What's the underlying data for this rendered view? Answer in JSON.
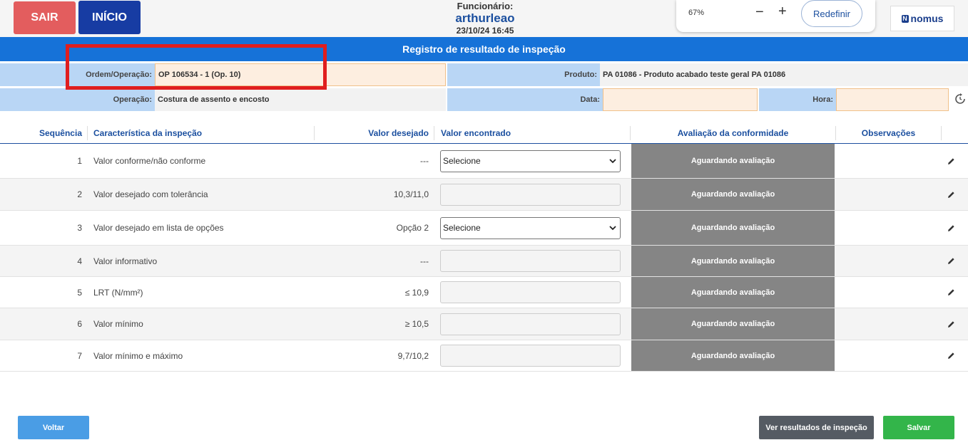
{
  "header": {
    "sair_label": "SAIR",
    "inicio_label": "INÍCIO",
    "funcionario_label": "Funcionário:",
    "funcionario_user": "arthurleao",
    "datetime": "23/10/24 16:45",
    "zoom_value": "67%",
    "zoom_minus": "−",
    "zoom_plus": "+",
    "reset_label": "Redefinir",
    "logo_text": "nomus"
  },
  "title": "Registro de resultado de inspeção",
  "info": {
    "ordem_label": "Ordem/Operação:",
    "ordem_value": "OP 106534 - 1 (Op. 10)",
    "produto_label": "Produto:",
    "produto_value": "PA 01086 - Produto acabado teste geral PA 01086",
    "operacao_label": "Operação:",
    "operacao_value": "Costura de assento e encosto",
    "data_label": "Data:",
    "data_value": "",
    "hora_label": "Hora:",
    "hora_value": ""
  },
  "table": {
    "headers": {
      "seq": "Sequência",
      "car": "Característica da inspeção",
      "des": "Valor desejado",
      "enc": "Valor encontrado",
      "aval": "Avaliação da conformidade",
      "obs": "Observações"
    },
    "rows": [
      {
        "seq": "1",
        "car": "Valor conforme/não conforme",
        "des": "---",
        "enc_type": "select",
        "enc_value": "Selecione",
        "aval": "Aguardando avaliação"
      },
      {
        "seq": "2",
        "car": "Valor desejado com tolerância",
        "des": "10,3/11,0",
        "enc_type": "input",
        "enc_value": "",
        "aval": "Aguardando avaliação"
      },
      {
        "seq": "3",
        "car": "Valor desejado em lista de opções",
        "des": "Opção 2",
        "enc_type": "select",
        "enc_value": "Selecione",
        "aval": "Aguardando avaliação"
      },
      {
        "seq": "4",
        "car": "Valor informativo",
        "des": "---",
        "enc_type": "input",
        "enc_value": "",
        "aval": "Aguardando avaliação"
      },
      {
        "seq": "5",
        "car": "LRT (N/mm²)",
        "des": "≤ 10,9",
        "enc_type": "input",
        "enc_value": "",
        "aval": "Aguardando avaliação"
      },
      {
        "seq": "6",
        "car": "Valor mínimo",
        "des": "≥ 10,5",
        "enc_type": "input",
        "enc_value": "",
        "aval": "Aguardando avaliação"
      },
      {
        "seq": "7",
        "car": "Valor mínimo e máximo",
        "des": "9,7/10,2",
        "enc_type": "input",
        "enc_value": "",
        "aval": "Aguardando avaliação"
      }
    ]
  },
  "footer": {
    "voltar_label": "Voltar",
    "ver_label": "Ver resultados de inspeção",
    "salvar_label": "Salvar"
  },
  "colors": {
    "sair": "#e35d5e",
    "inicio": "#173ca3",
    "title_bar": "#1672d8",
    "label_bg": "#b9d6f5",
    "peach_field": "#fdeee0",
    "aval_bg": "#858585",
    "voltar": "#4a9de5",
    "ver": "#555b63",
    "salvar": "#33b54a",
    "highlight": "#e01e1e"
  }
}
